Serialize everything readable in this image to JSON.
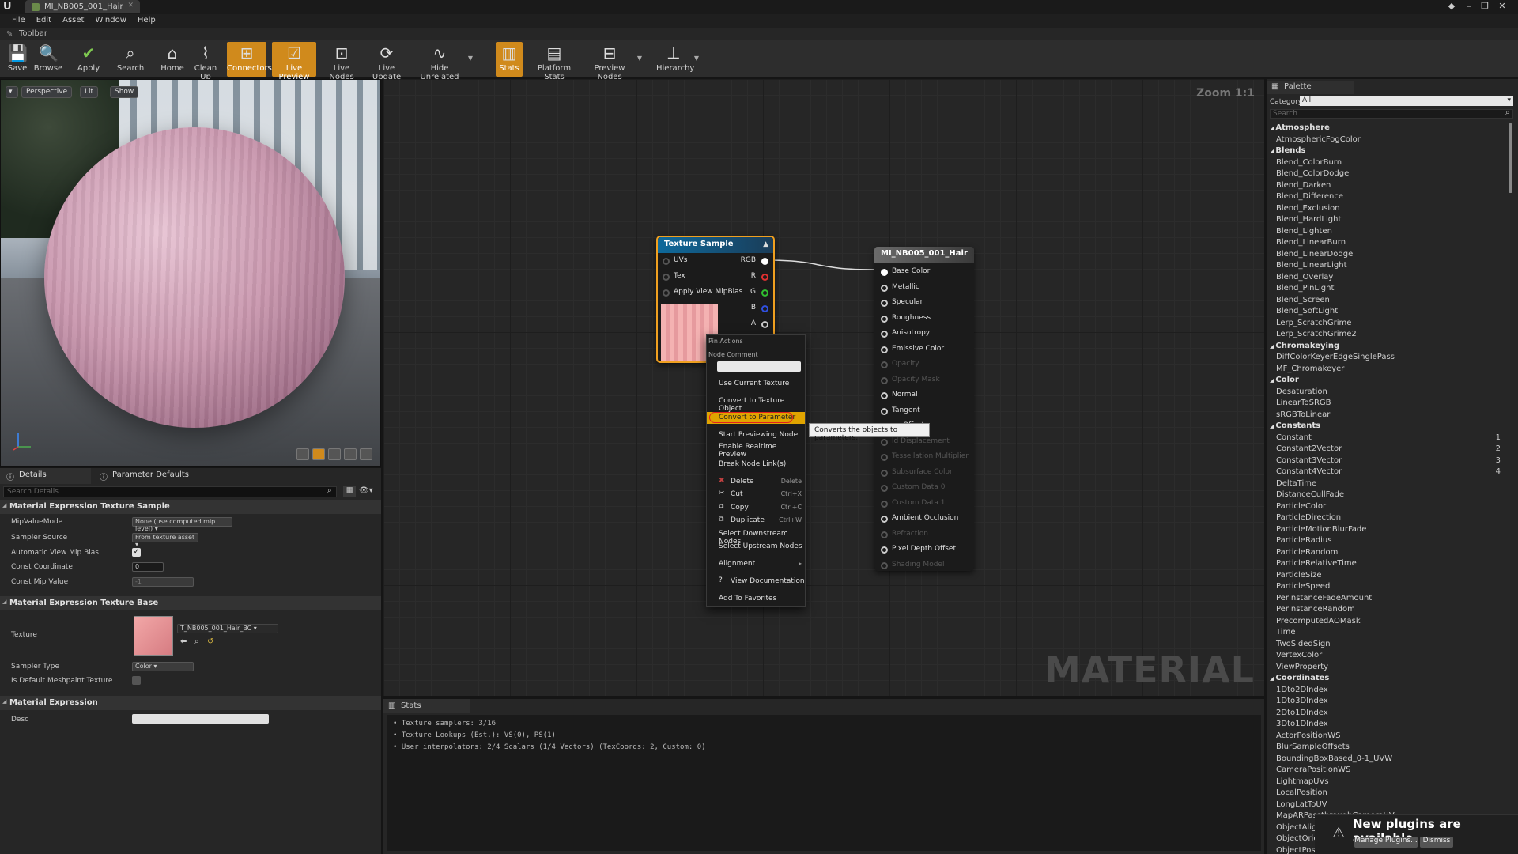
{
  "window": {
    "tab_title": "MI_NB005_001_Hair"
  },
  "menu": [
    "File",
    "Edit",
    "Asset",
    "Window",
    "Help"
  ],
  "toolbar": {
    "label": "Toolbar",
    "buttons": [
      {
        "label": "Save",
        "icon": "save-icon",
        "active": false
      },
      {
        "label": "Browse",
        "icon": "browse-icon",
        "active": false
      },
      {
        "label": "Apply",
        "icon": "check-icon",
        "active": false
      },
      {
        "label": "Search",
        "icon": "search-icon",
        "active": false
      },
      {
        "label": "Home",
        "icon": "home-icon",
        "active": false
      },
      {
        "label": "Clean Up",
        "icon": "broom-icon",
        "active": false
      },
      {
        "label": "Connectors",
        "icon": "connectors-icon",
        "active": true
      },
      {
        "label": "Live Preview",
        "icon": "live-preview-icon",
        "active": true
      },
      {
        "label": "Live Nodes",
        "icon": "live-nodes-icon",
        "active": false
      },
      {
        "label": "Live Update",
        "icon": "live-update-icon",
        "active": false
      },
      {
        "label": "Hide Unrelated",
        "icon": "hide-unrelated-icon",
        "active": false
      },
      {
        "label": "Stats",
        "icon": "stats-icon",
        "active": true
      },
      {
        "label": "Platform Stats",
        "icon": "platform-stats-icon",
        "active": false
      },
      {
        "label": "Preview Nodes",
        "icon": "preview-nodes-icon",
        "active": false
      },
      {
        "label": "Hierarchy",
        "icon": "hierarchy-icon",
        "active": false
      }
    ]
  },
  "viewport": {
    "perspective": "Perspective",
    "lit": "Lit",
    "show": "Show"
  },
  "details": {
    "tab_details": "Details",
    "tab_params": "Parameter Defaults",
    "search_placeholder": "Search Details",
    "sec1": "Material Expression Texture Sample",
    "mip_label": "MipValueMode",
    "mip_value": "None (use computed mip level)",
    "sampler_source_label": "Sampler Source",
    "sampler_source_value": "From texture asset",
    "auto_mip_label": "Automatic View Mip Bias",
    "const_coord_label": "Const Coordinate",
    "const_coord_value": "0",
    "const_mip_label": "Const Mip Value",
    "const_mip_value": "-1",
    "sec2": "Material Expression Texture Base",
    "texture_label": "Texture",
    "texture_value": "T_NB005_001_Hair_BC",
    "sampler_type_label": "Sampler Type",
    "sampler_type_value": "Color",
    "meshpaint_label": "Is Default Meshpaint Texture",
    "sec3": "Material Expression",
    "desc_label": "Desc"
  },
  "graph": {
    "zoom": "Zoom 1:1",
    "watermark": "MATERIAL",
    "texture_node": {
      "title": "Texture Sample",
      "inputs": [
        "UVs",
        "Tex",
        "Apply View MipBias"
      ],
      "outputs": [
        "RGB",
        "R",
        "G",
        "B",
        "A"
      ]
    },
    "material_node": {
      "title": "MI_NB005_001_Hair",
      "pins": [
        {
          "label": "Base Color",
          "enabled": true
        },
        {
          "label": "Metallic",
          "enabled": true
        },
        {
          "label": "Specular",
          "enabled": true
        },
        {
          "label": "Roughness",
          "enabled": true
        },
        {
          "label": "Anisotropy",
          "enabled": true
        },
        {
          "label": "Emissive Color",
          "enabled": true
        },
        {
          "label": "Opacity",
          "enabled": false
        },
        {
          "label": "Opacity Mask",
          "enabled": false
        },
        {
          "label": "Normal",
          "enabled": true
        },
        {
          "label": "Tangent",
          "enabled": true
        },
        {
          "label": "on Offset",
          "enabled": true
        },
        {
          "label": "ld Displacement",
          "enabled": false
        },
        {
          "label": "Tessellation Multiplier",
          "enabled": false
        },
        {
          "label": "Subsurface Color",
          "enabled": false
        },
        {
          "label": "Custom Data 0",
          "enabled": false
        },
        {
          "label": "Custom Data 1",
          "enabled": false
        },
        {
          "label": "Ambient Occlusion",
          "enabled": true
        },
        {
          "label": "Refraction",
          "enabled": false
        },
        {
          "label": "Pixel Depth Offset",
          "enabled": true
        },
        {
          "label": "Shading Model",
          "enabled": false
        }
      ]
    },
    "context_menu": {
      "header_pin": "Pin Actions",
      "header_comment": "Node Comment",
      "use_current_texture": "Use Current Texture",
      "convert_texture_object": "Convert to Texture Object",
      "convert_parameter": "Convert to Parameter",
      "start_preview": "Start Previewing Node",
      "enable_realtime": "Enable Realtime Preview",
      "break_links": "Break Node Link(s)",
      "delete": "Delete",
      "delete_sc": "Delete",
      "cut": "Cut",
      "cut_sc": "Ctrl+X",
      "copy": "Copy",
      "copy_sc": "Ctrl+C",
      "duplicate": "Duplicate",
      "duplicate_sc": "Ctrl+W",
      "select_downstream": "Select Downstream Nodes",
      "select_upstream": "Select Upstream Nodes",
      "alignment": "Alignment",
      "view_docs": "View Documentation",
      "add_favorites": "Add To Favorites"
    },
    "tooltip": "Converts the objects to parameters."
  },
  "stats": {
    "tab": "Stats",
    "lines": [
      "• Texture samplers: 3/16",
      "• Texture Lookups (Est.): VS(0), PS(1)",
      "• User interpolators: 2/4 Scalars (1/4 Vectors) (TexCoords: 2, Custom: 0)"
    ]
  },
  "palette": {
    "tab": "Palette",
    "category_label": "Category:",
    "category_value": "All",
    "search_placeholder": "Search",
    "groups": [
      {
        "name": "Atmosphere",
        "items": [
          "AtmosphericFogColor"
        ]
      },
      {
        "name": "Blends",
        "items": [
          "Blend_ColorBurn",
          "Blend_ColorDodge",
          "Blend_Darken",
          "Blend_Difference",
          "Blend_Exclusion",
          "Blend_HardLight",
          "Blend_Lighten",
          "Blend_LinearBurn",
          "Blend_LinearDodge",
          "Blend_LinearLight",
          "Blend_Overlay",
          "Blend_PinLight",
          "Blend_Screen",
          "Blend_SoftLight",
          "Lerp_ScratchGrime",
          "Lerp_ScratchGrime2"
        ]
      },
      {
        "name": "Chromakeying",
        "items": [
          "DiffColorKeyerEdgeSinglePass",
          "MF_Chromakeyer"
        ]
      },
      {
        "name": "Color",
        "items": [
          "Desaturation",
          "LinearToSRGB",
          "sRGBToLinear"
        ]
      },
      {
        "name": "Constants",
        "items": [
          "Constant",
          "Constant2Vector",
          "Constant3Vector",
          "Constant4Vector",
          "DeltaTime",
          "DistanceCullFade",
          "ParticleColor",
          "ParticleDirection",
          "ParticleMotionBlurFade",
          "ParticleRadius",
          "ParticleRandom",
          "ParticleRelativeTime",
          "ParticleSize",
          "ParticleSpeed",
          "PerInstanceFadeAmount",
          "PerInstanceRandom",
          "PrecomputedAOMask",
          "Time",
          "TwoSidedSign",
          "VertexColor",
          "ViewProperty"
        ]
      },
      {
        "name": "Coordinates",
        "items": [
          "1Dto2DIndex",
          "1Dto3DIndex",
          "2Dto1DIndex",
          "3Dto1DIndex",
          "ActorPositionWS",
          "BlurSampleOffsets",
          "BoundingBoxBased_0-1_UVW",
          "CameraPositionWS",
          "LightmapUVs",
          "LocalPosition",
          "LongLatToUV",
          "MapARPassthroughCameraUV",
          "ObjectAlignedX",
          "ObjectOrientation",
          "ObjectPosition"
        ]
      }
    ],
    "constant_keys": [
      "1",
      "2",
      "3",
      "4"
    ]
  },
  "notification": {
    "text": "New plugins are available",
    "manage": "Manage Plugins...",
    "dismiss": "Dismiss"
  }
}
